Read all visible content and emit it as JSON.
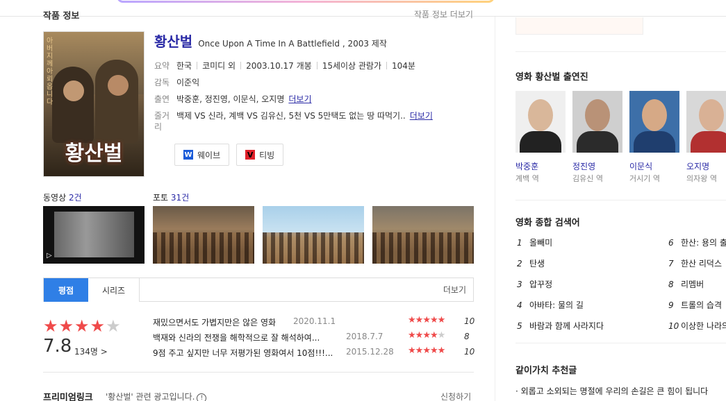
{
  "header": {
    "section_title": "작품 정보",
    "section_more": "작품 정보 더보기"
  },
  "movie": {
    "poster_title": "황산벌",
    "poster_tagline": "아버지께 아뢰옵니다",
    "title": "황산벌",
    "original_title": "Once Upon A Time In A Battlefield , 2003 제작",
    "summary_label": "요약",
    "summary": [
      "한국",
      "코미디 외",
      "2003.10.17 개봉",
      "15세이상 관람가",
      "104분"
    ],
    "director_label": "감독",
    "director": "이준익",
    "cast_label": "출연",
    "cast": "박중훈, 정진영, 이문식, 오지명",
    "cast_more": "더보기",
    "plot_label": "줄거리",
    "plot": "백제 VS 신라, 계백 VS 김유신, 5천 VS 5만택도 없는 땅 따먹기..",
    "plot_more": "더보기",
    "watch": [
      {
        "icon": "W",
        "label": "웨이브"
      },
      {
        "icon": "V",
        "label": "티빙"
      }
    ]
  },
  "media": {
    "video_label": "동영상",
    "video_count": "2건",
    "photo_label": "포토",
    "photo_count": "31건"
  },
  "tabs": {
    "items": [
      "평점",
      "시리즈"
    ],
    "more": "더보기"
  },
  "rating": {
    "stars": 4,
    "max_stars": 5,
    "score": "7.8",
    "count": "134명 >",
    "reviews": [
      {
        "text": "재밌으면서도 가볍지만은 않은 영화",
        "date": "2020.11.1",
        "stars": 5,
        "score": "10"
      },
      {
        "text": "백재와 신라의 전쟁을 해학적으로 잘 해석하여...",
        "date": "2018.7.7",
        "stars": 4,
        "score": "8"
      },
      {
        "text": "9점 주고 싶지만 너무 저평가된 영화여서 10점!!!...",
        "date": "2015.12.28",
        "stars": 5,
        "score": "10"
      }
    ]
  },
  "premium": {
    "title": "프리미엄링크",
    "desc": "'황산벌' 관련 광고입니다.",
    "info": "!",
    "apply": "신청하기"
  },
  "sidebar": {
    "cast_title": "영화 황산벌 출연진",
    "cast": [
      {
        "name": "박중훈",
        "role": "계백 역",
        "skin": "#d9b79a",
        "cloth": "#222222",
        "bg": "#efefef"
      },
      {
        "name": "정진영",
        "role": "김유신 역",
        "skin": "#b99277",
        "cloth": "#2b2b2b",
        "bg": "#cfcfcf"
      },
      {
        "name": "이문식",
        "role": "거시기 역",
        "skin": "#d6a986",
        "cloth": "#1f3e6e",
        "bg": "#3d6fa8"
      },
      {
        "name": "오지명",
        "role": "의자왕 역",
        "skin": "#d9b195",
        "cloth": "#b23030",
        "bg": "#d8d8d8"
      }
    ],
    "keywords_title": "영화 종합 검색어",
    "keywords_left": [
      {
        "rank": "1",
        "text": "올빼미"
      },
      {
        "rank": "2",
        "text": "탄생"
      },
      {
        "rank": "3",
        "text": "압꾸정"
      },
      {
        "rank": "4",
        "text": "아바타: 물의 길"
      },
      {
        "rank": "5",
        "text": "바람과 함께 사라지다"
      }
    ],
    "keywords_right": [
      {
        "rank": "6",
        "text": "한산: 용의 출현"
      },
      {
        "rank": "7",
        "text": "한산 리덕스"
      },
      {
        "rank": "8",
        "text": "리멤버"
      },
      {
        "rank": "9",
        "text": "트롤의 습격"
      },
      {
        "rank": "10",
        "text": "이상한 나라의 수학자"
      }
    ],
    "together_title": "같이가치 추천글",
    "together_item": "외롭고 소외되는 명절에 우리의 손길은 큰 힘이 됩니다"
  }
}
